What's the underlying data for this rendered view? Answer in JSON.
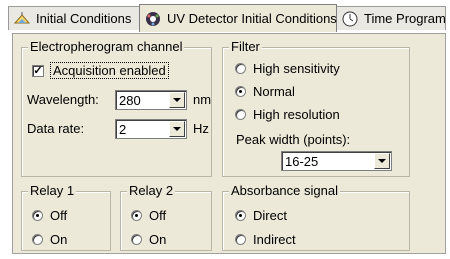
{
  "tabs": [
    {
      "label": "Initial Conditions",
      "icon": "flask-icon"
    },
    {
      "label": "UV Detector Initial Conditions",
      "icon": "detector-icon"
    },
    {
      "label": "Time Program",
      "icon": "clock-icon"
    }
  ],
  "electropherogram": {
    "legend": "Electropherogram channel",
    "acquisition_label": "Acquisition enabled",
    "acquisition_checked": true,
    "wavelength_label": "Wavelength:",
    "wavelength_value": "280",
    "wavelength_unit": "nm",
    "datarate_label": "Data rate:",
    "datarate_value": "2",
    "datarate_unit": "Hz"
  },
  "filter": {
    "legend": "Filter",
    "options": [
      "High sensitivity",
      "Normal",
      "High resolution"
    ],
    "selected": "Normal",
    "peak_width_label": "Peak width (points):",
    "peak_width_value": "16-25"
  },
  "relay1": {
    "legend": "Relay 1",
    "off": "Off",
    "on": "On",
    "selected": "Off"
  },
  "relay2": {
    "legend": "Relay 2",
    "off": "Off",
    "on": "On",
    "selected": "Off"
  },
  "absorbance": {
    "legend": "Absorbance signal",
    "direct": "Direct",
    "indirect": "Indirect",
    "selected": "Direct"
  }
}
